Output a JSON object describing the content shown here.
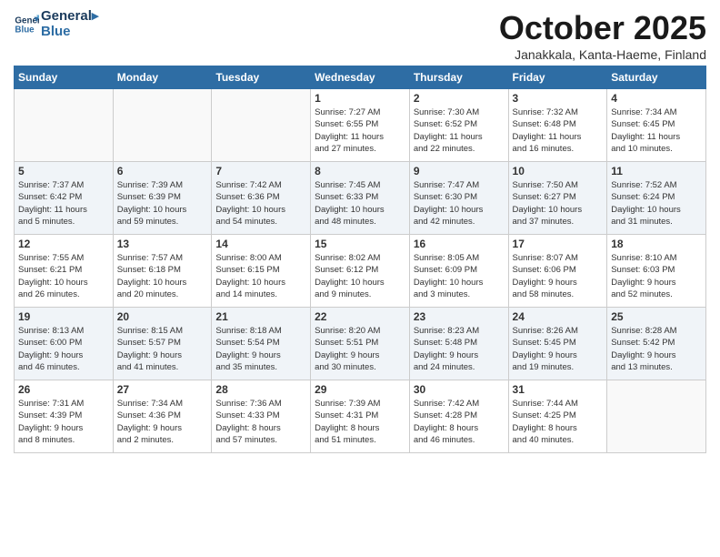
{
  "header": {
    "logo_line1": "General",
    "logo_line2": "Blue",
    "month": "October 2025",
    "location": "Janakkala, Kanta-Haeme, Finland"
  },
  "days_of_week": [
    "Sunday",
    "Monday",
    "Tuesday",
    "Wednesday",
    "Thursday",
    "Friday",
    "Saturday"
  ],
  "weeks": [
    [
      {
        "day": "",
        "info": ""
      },
      {
        "day": "",
        "info": ""
      },
      {
        "day": "",
        "info": ""
      },
      {
        "day": "1",
        "info": "Sunrise: 7:27 AM\nSunset: 6:55 PM\nDaylight: 11 hours\nand 27 minutes."
      },
      {
        "day": "2",
        "info": "Sunrise: 7:30 AM\nSunset: 6:52 PM\nDaylight: 11 hours\nand 22 minutes."
      },
      {
        "day": "3",
        "info": "Sunrise: 7:32 AM\nSunset: 6:48 PM\nDaylight: 11 hours\nand 16 minutes."
      },
      {
        "day": "4",
        "info": "Sunrise: 7:34 AM\nSunset: 6:45 PM\nDaylight: 11 hours\nand 10 minutes."
      }
    ],
    [
      {
        "day": "5",
        "info": "Sunrise: 7:37 AM\nSunset: 6:42 PM\nDaylight: 11 hours\nand 5 minutes."
      },
      {
        "day": "6",
        "info": "Sunrise: 7:39 AM\nSunset: 6:39 PM\nDaylight: 10 hours\nand 59 minutes."
      },
      {
        "day": "7",
        "info": "Sunrise: 7:42 AM\nSunset: 6:36 PM\nDaylight: 10 hours\nand 54 minutes."
      },
      {
        "day": "8",
        "info": "Sunrise: 7:45 AM\nSunset: 6:33 PM\nDaylight: 10 hours\nand 48 minutes."
      },
      {
        "day": "9",
        "info": "Sunrise: 7:47 AM\nSunset: 6:30 PM\nDaylight: 10 hours\nand 42 minutes."
      },
      {
        "day": "10",
        "info": "Sunrise: 7:50 AM\nSunset: 6:27 PM\nDaylight: 10 hours\nand 37 minutes."
      },
      {
        "day": "11",
        "info": "Sunrise: 7:52 AM\nSunset: 6:24 PM\nDaylight: 10 hours\nand 31 minutes."
      }
    ],
    [
      {
        "day": "12",
        "info": "Sunrise: 7:55 AM\nSunset: 6:21 PM\nDaylight: 10 hours\nand 26 minutes."
      },
      {
        "day": "13",
        "info": "Sunrise: 7:57 AM\nSunset: 6:18 PM\nDaylight: 10 hours\nand 20 minutes."
      },
      {
        "day": "14",
        "info": "Sunrise: 8:00 AM\nSunset: 6:15 PM\nDaylight: 10 hours\nand 14 minutes."
      },
      {
        "day": "15",
        "info": "Sunrise: 8:02 AM\nSunset: 6:12 PM\nDaylight: 10 hours\nand 9 minutes."
      },
      {
        "day": "16",
        "info": "Sunrise: 8:05 AM\nSunset: 6:09 PM\nDaylight: 10 hours\nand 3 minutes."
      },
      {
        "day": "17",
        "info": "Sunrise: 8:07 AM\nSunset: 6:06 PM\nDaylight: 9 hours\nand 58 minutes."
      },
      {
        "day": "18",
        "info": "Sunrise: 8:10 AM\nSunset: 6:03 PM\nDaylight: 9 hours\nand 52 minutes."
      }
    ],
    [
      {
        "day": "19",
        "info": "Sunrise: 8:13 AM\nSunset: 6:00 PM\nDaylight: 9 hours\nand 46 minutes."
      },
      {
        "day": "20",
        "info": "Sunrise: 8:15 AM\nSunset: 5:57 PM\nDaylight: 9 hours\nand 41 minutes."
      },
      {
        "day": "21",
        "info": "Sunrise: 8:18 AM\nSunset: 5:54 PM\nDaylight: 9 hours\nand 35 minutes."
      },
      {
        "day": "22",
        "info": "Sunrise: 8:20 AM\nSunset: 5:51 PM\nDaylight: 9 hours\nand 30 minutes."
      },
      {
        "day": "23",
        "info": "Sunrise: 8:23 AM\nSunset: 5:48 PM\nDaylight: 9 hours\nand 24 minutes."
      },
      {
        "day": "24",
        "info": "Sunrise: 8:26 AM\nSunset: 5:45 PM\nDaylight: 9 hours\nand 19 minutes."
      },
      {
        "day": "25",
        "info": "Sunrise: 8:28 AM\nSunset: 5:42 PM\nDaylight: 9 hours\nand 13 minutes."
      }
    ],
    [
      {
        "day": "26",
        "info": "Sunrise: 7:31 AM\nSunset: 4:39 PM\nDaylight: 9 hours\nand 8 minutes."
      },
      {
        "day": "27",
        "info": "Sunrise: 7:34 AM\nSunset: 4:36 PM\nDaylight: 9 hours\nand 2 minutes."
      },
      {
        "day": "28",
        "info": "Sunrise: 7:36 AM\nSunset: 4:33 PM\nDaylight: 8 hours\nand 57 minutes."
      },
      {
        "day": "29",
        "info": "Sunrise: 7:39 AM\nSunset: 4:31 PM\nDaylight: 8 hours\nand 51 minutes."
      },
      {
        "day": "30",
        "info": "Sunrise: 7:42 AM\nSunset: 4:28 PM\nDaylight: 8 hours\nand 46 minutes."
      },
      {
        "day": "31",
        "info": "Sunrise: 7:44 AM\nSunset: 4:25 PM\nDaylight: 8 hours\nand 40 minutes."
      },
      {
        "day": "",
        "info": ""
      }
    ]
  ]
}
